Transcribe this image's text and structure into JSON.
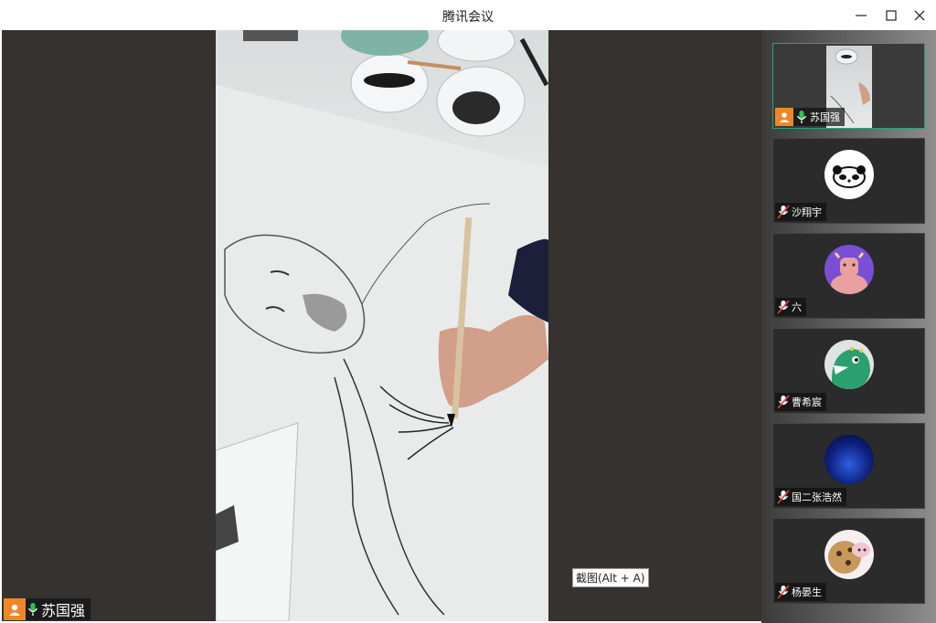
{
  "window": {
    "title": "腾讯会议"
  },
  "main": {
    "speaker": {
      "name": "苏国强"
    },
    "tooltip": "截图(Alt + A)"
  },
  "participants": [
    {
      "name": "苏国强",
      "muted": false,
      "avatar": "video-thumbnail"
    },
    {
      "name": "沙翔宇",
      "muted": true,
      "avatar": "panda-avatar"
    },
    {
      "name": "六",
      "muted": true,
      "avatar": "cow-avatar"
    },
    {
      "name": "曹希宸",
      "muted": true,
      "avatar": "dinosaur-avatar"
    },
    {
      "name": "国二张浩然",
      "muted": true,
      "avatar": "blue-space-avatar"
    },
    {
      "name": "杨晏生",
      "muted": true,
      "avatar": "cookie-avatar"
    }
  ],
  "colors": {
    "accent_orange": "#f0862a",
    "mic_green": "#2fc35b",
    "mic_muted_red": "#e04040",
    "active_border": "#2ea36b"
  }
}
